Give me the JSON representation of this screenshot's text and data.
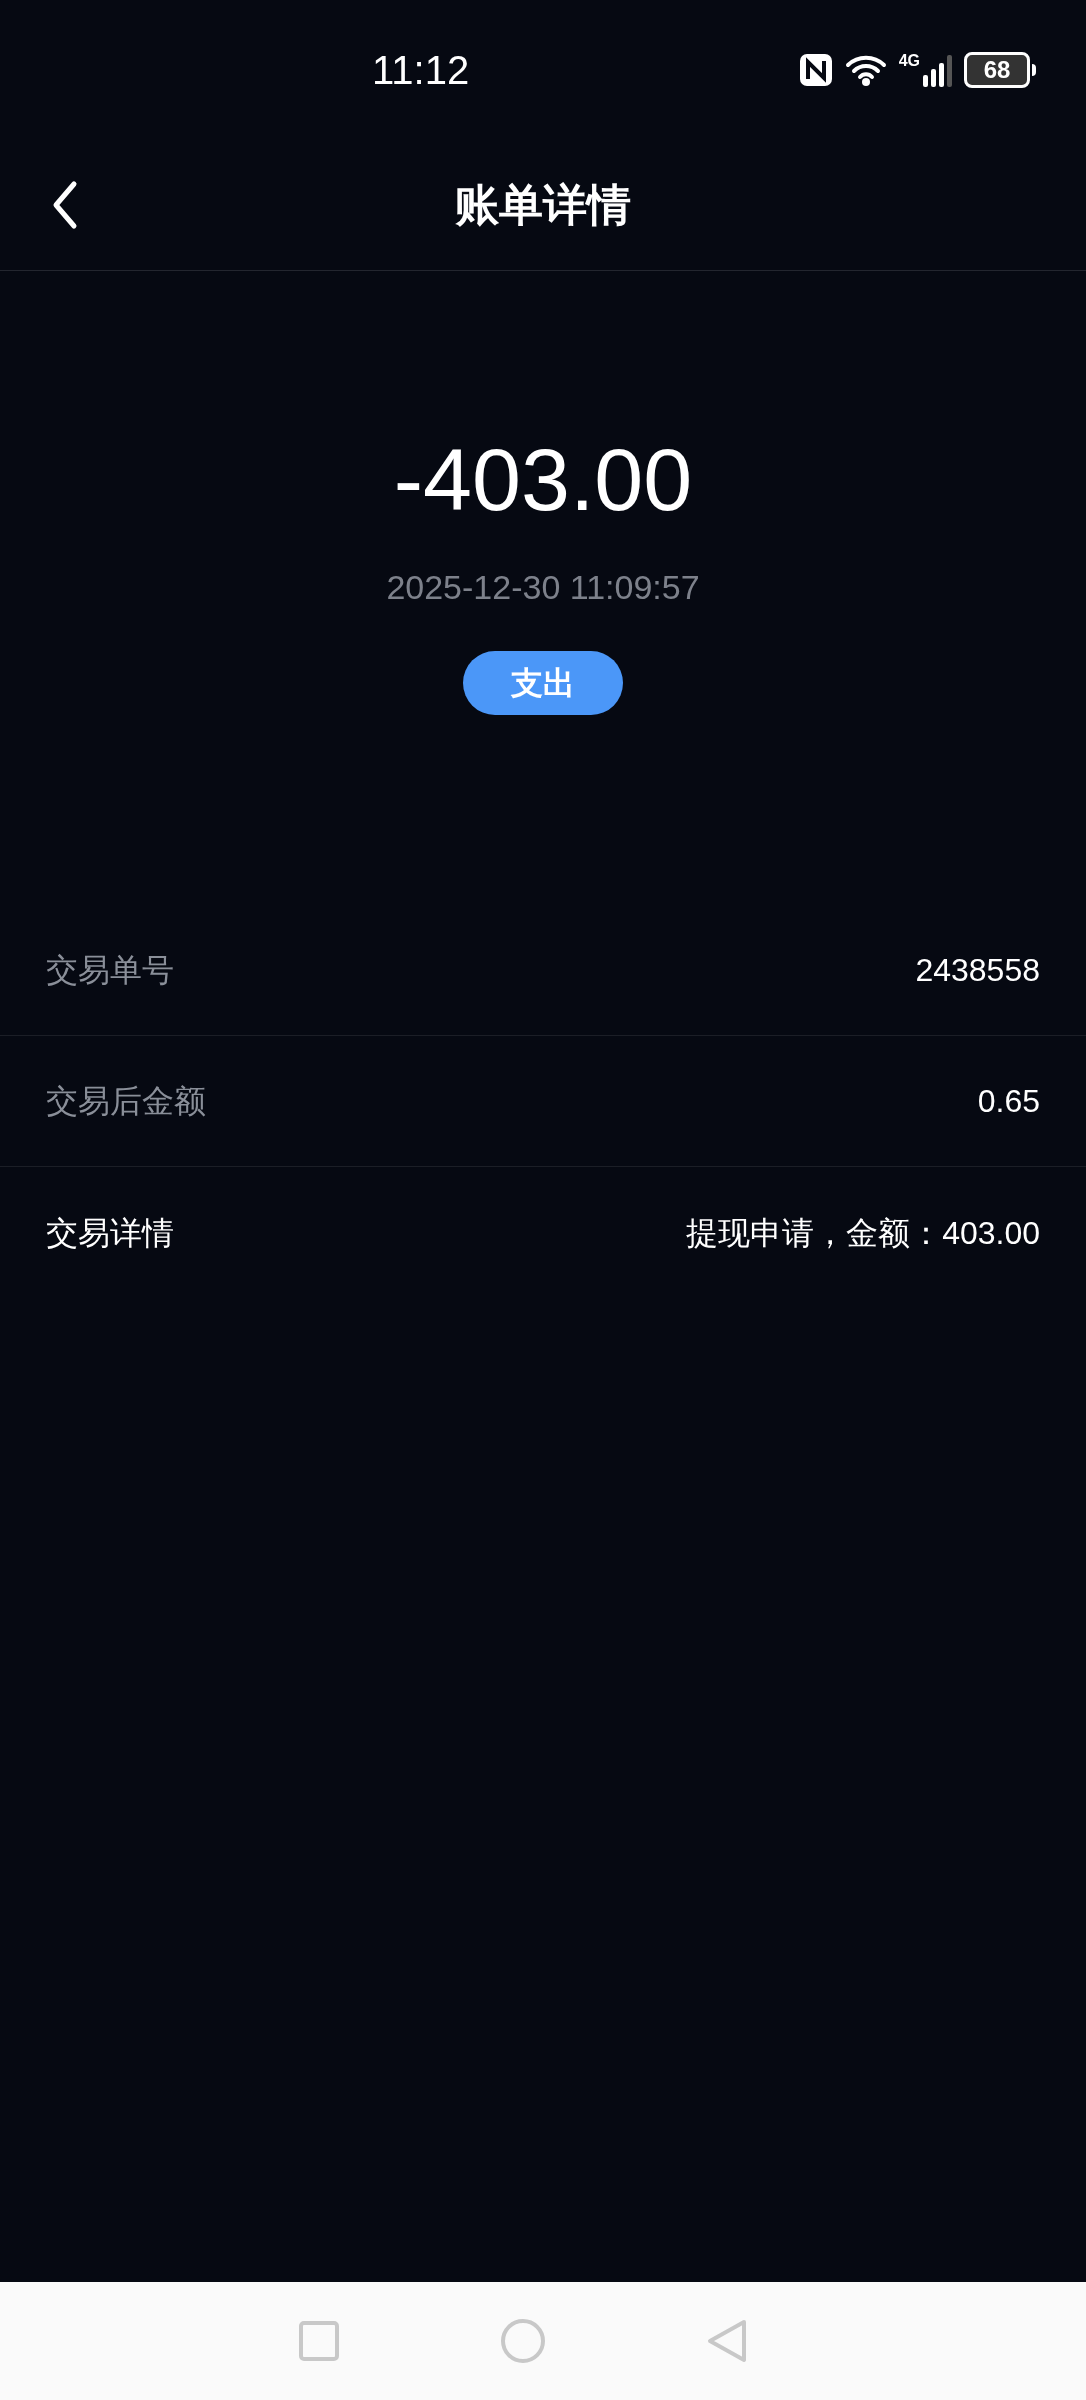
{
  "status_bar": {
    "time": "11:12",
    "battery": "68",
    "network": "4G"
  },
  "header": {
    "title": "账单详情"
  },
  "summary": {
    "amount": "-403.00",
    "datetime": "2025-12-30 11:09:57",
    "type_badge": "支出"
  },
  "rows": [
    {
      "kind": "field",
      "label": "交易单号",
      "value": "2438558"
    },
    {
      "kind": "field",
      "label": "交易后金额",
      "value": "0.65"
    },
    {
      "kind": "detail",
      "label": "交易详情",
      "value": "提现申请，金额：403.00"
    }
  ]
}
